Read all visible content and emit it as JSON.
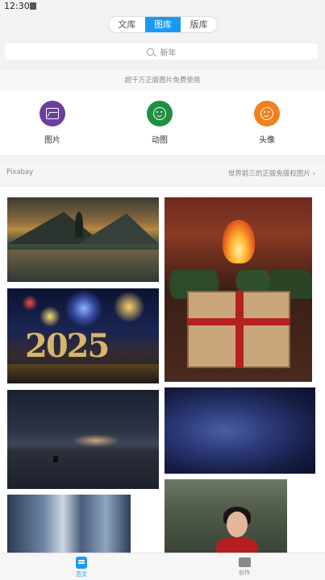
{
  "status_bar": {
    "time": "12:30"
  },
  "top_tabs": [
    {
      "label": "文库",
      "active": false
    },
    {
      "label": "图库",
      "active": true
    },
    {
      "label": "版库",
      "active": false
    }
  ],
  "search": {
    "placeholder": "新年"
  },
  "tagline": "超千万正版图片免费使用",
  "categories": [
    {
      "label": "图片",
      "color": "#6a3f9e",
      "icon": "picture-icon"
    },
    {
      "label": "动图",
      "color": "#1f9040",
      "icon": "smiley-icon"
    },
    {
      "label": "头像",
      "color": "#f0801d",
      "icon": "smiley-icon"
    }
  ],
  "source": {
    "name": "Pixabay",
    "link": "世界前三的正版免版权图片 ›"
  },
  "images": [
    "lake-mountains-photo",
    "fireplace-christmas-gift-photo",
    "fireworks-2025-photo",
    "night-sky-boat-photo",
    "starry-milky-way-photo",
    "glass-building-photo",
    "portrait-woman-red-dress-photo"
  ],
  "tile_text": {
    "year": "2025"
  },
  "bottom_nav": [
    {
      "label": "范文",
      "active": true,
      "icon": "document-icon"
    },
    {
      "label": "创作",
      "active": false,
      "icon": "create-icon"
    }
  ],
  "colors": {
    "accent": "#1a98f5"
  }
}
